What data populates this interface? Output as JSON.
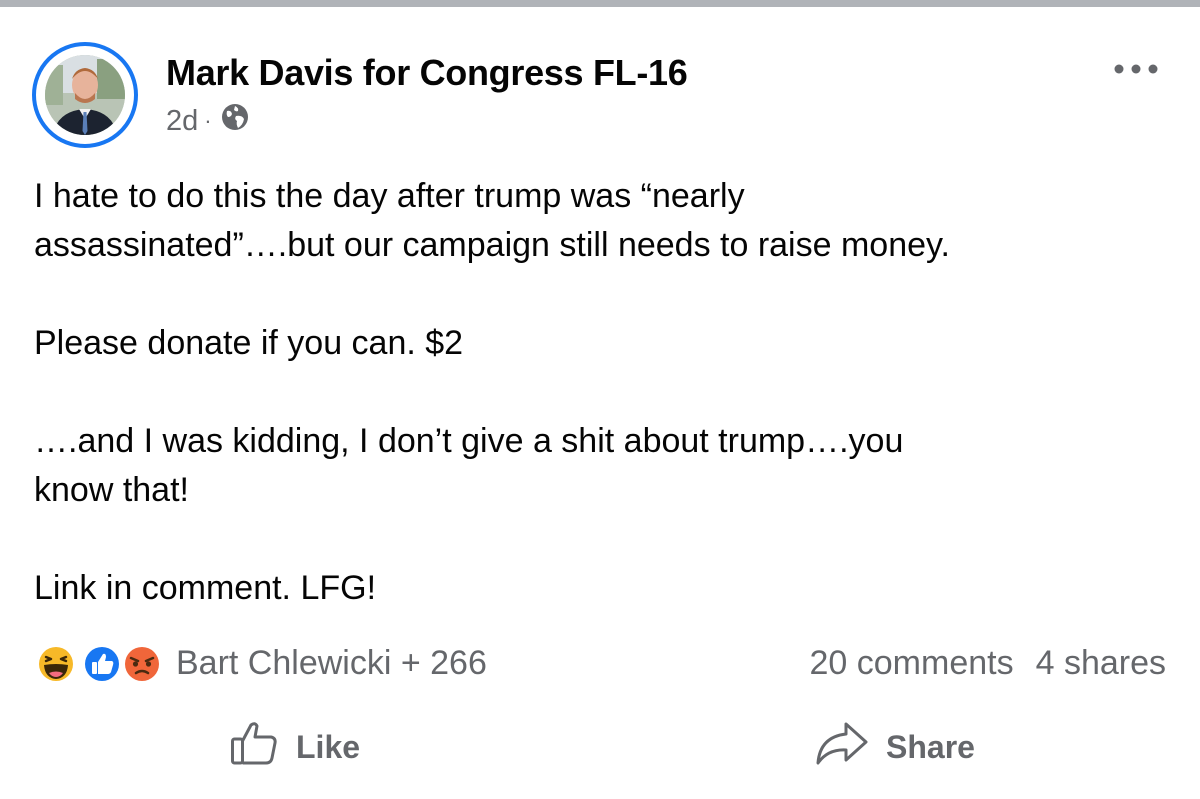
{
  "post": {
    "author": "Mark Davis for Congress FL-16",
    "timestamp": "2d",
    "separator": "·",
    "privacy_icon": "globe-icon",
    "more_icon": "more-options-icon",
    "body": {
      "line1": "I hate to do this the day after trump was “nearly",
      "line2": "assassinated”….but our campaign still needs to raise money.",
      "line3": "Please donate if you can. $2",
      "line4": "….and I was kidding, I don’t give a shit about trump….you",
      "line5": "know that!",
      "line6": "Link in comment. LFG!"
    }
  },
  "reactions": {
    "icons": [
      "laughing-reaction-icon",
      "like-reaction-icon",
      "angry-reaction-icon"
    ],
    "names": "Bart Chlewicki + 266",
    "comments": "20 comments",
    "shares": "4 shares"
  },
  "actions": {
    "like": "Like",
    "share": "Share"
  },
  "colors": {
    "accent": "#1877f2",
    "secondary_text": "#65676b",
    "primary_text": "#050505",
    "angry": "#f0663a",
    "haha": "#f7b928"
  }
}
